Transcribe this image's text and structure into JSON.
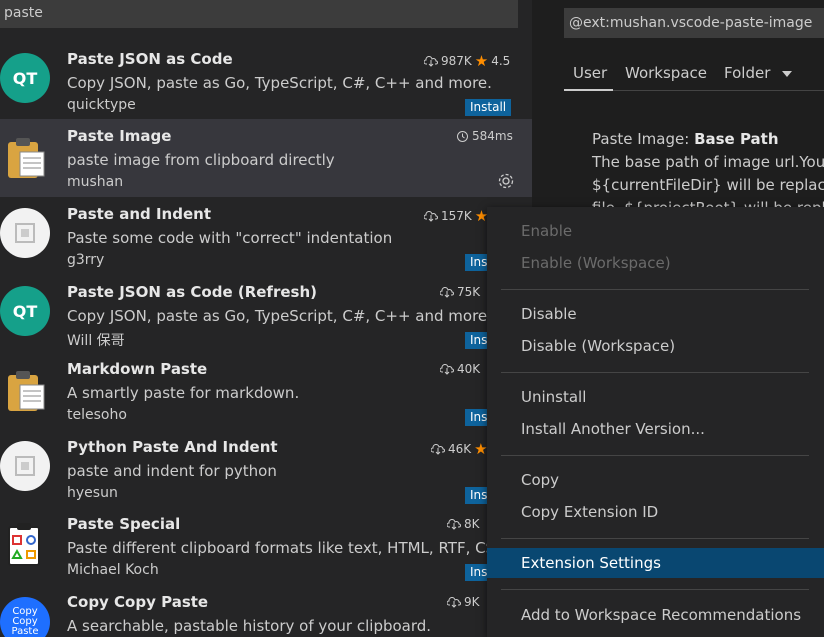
{
  "search": {
    "value": "paste"
  },
  "extensions": [
    {
      "name": "Paste JSON as Code",
      "desc": "Copy JSON, paste as Go, TypeScript, C#, C++ and more.",
      "publisher": "quicktype",
      "downloads": "987K",
      "rating": "4.5",
      "install_label": "Install",
      "logo_text": "QT"
    },
    {
      "name": "Paste Image",
      "desc": "paste image from clipboard directly",
      "publisher": "mushan",
      "load_time": "584ms"
    },
    {
      "name": "Paste and Indent",
      "desc": "Paste some code with \"correct\" indentation",
      "publisher": "g3rry",
      "downloads": "157K",
      "install_label": "Ins"
    },
    {
      "name": "Paste JSON as Code (Refresh)",
      "desc": "Copy JSON, paste as Go, TypeScript, C#, C++ and more.",
      "publisher": "Will 保哥",
      "downloads": "75K",
      "install_label": "Ins",
      "logo_text": "QT"
    },
    {
      "name": "Markdown Paste",
      "desc": "A smartly paste for markdown.",
      "publisher": "telesoho",
      "downloads": "40K",
      "install_label": "Ins"
    },
    {
      "name": "Python Paste And Indent",
      "desc": "paste and indent for python",
      "publisher": "hyesun",
      "downloads": "46K",
      "install_label": "Ins"
    },
    {
      "name": "Paste Special",
      "desc": "Paste different clipboard formats like text, HTML, RTF, CSV",
      "publisher": "Michael Koch",
      "downloads": "8K",
      "install_label": "Ins"
    },
    {
      "name": "Copy Copy Paste",
      "desc": "A searchable, pastable history of your clipboard.",
      "downloads": "9K",
      "logo_lines": [
        "Copy",
        "Copy",
        "Paste"
      ]
    }
  ],
  "settings": {
    "search_value": "@ext:mushan.vscode-paste-image",
    "tabs": [
      "User",
      "Workspace",
      "Folder"
    ],
    "title_prefix": "Paste Image: ",
    "title_name": "Base Path",
    "desc_lines": [
      "The base path of image url.You c",
      "${currentFileDir} will be replace b",
      "file. ${projectRoot} will be replac"
    ]
  },
  "context_menu": {
    "items": [
      "Enable",
      "Enable (Workspace)",
      "Disable",
      "Disable (Workspace)",
      "Uninstall",
      "Install Another Version...",
      "Copy",
      "Copy Extension ID",
      "Extension Settings",
      "Add to Workspace Recommendations"
    ]
  },
  "colors": {
    "accent": "#0e639c",
    "highlight": "#094771",
    "star": "#ff8e00"
  }
}
